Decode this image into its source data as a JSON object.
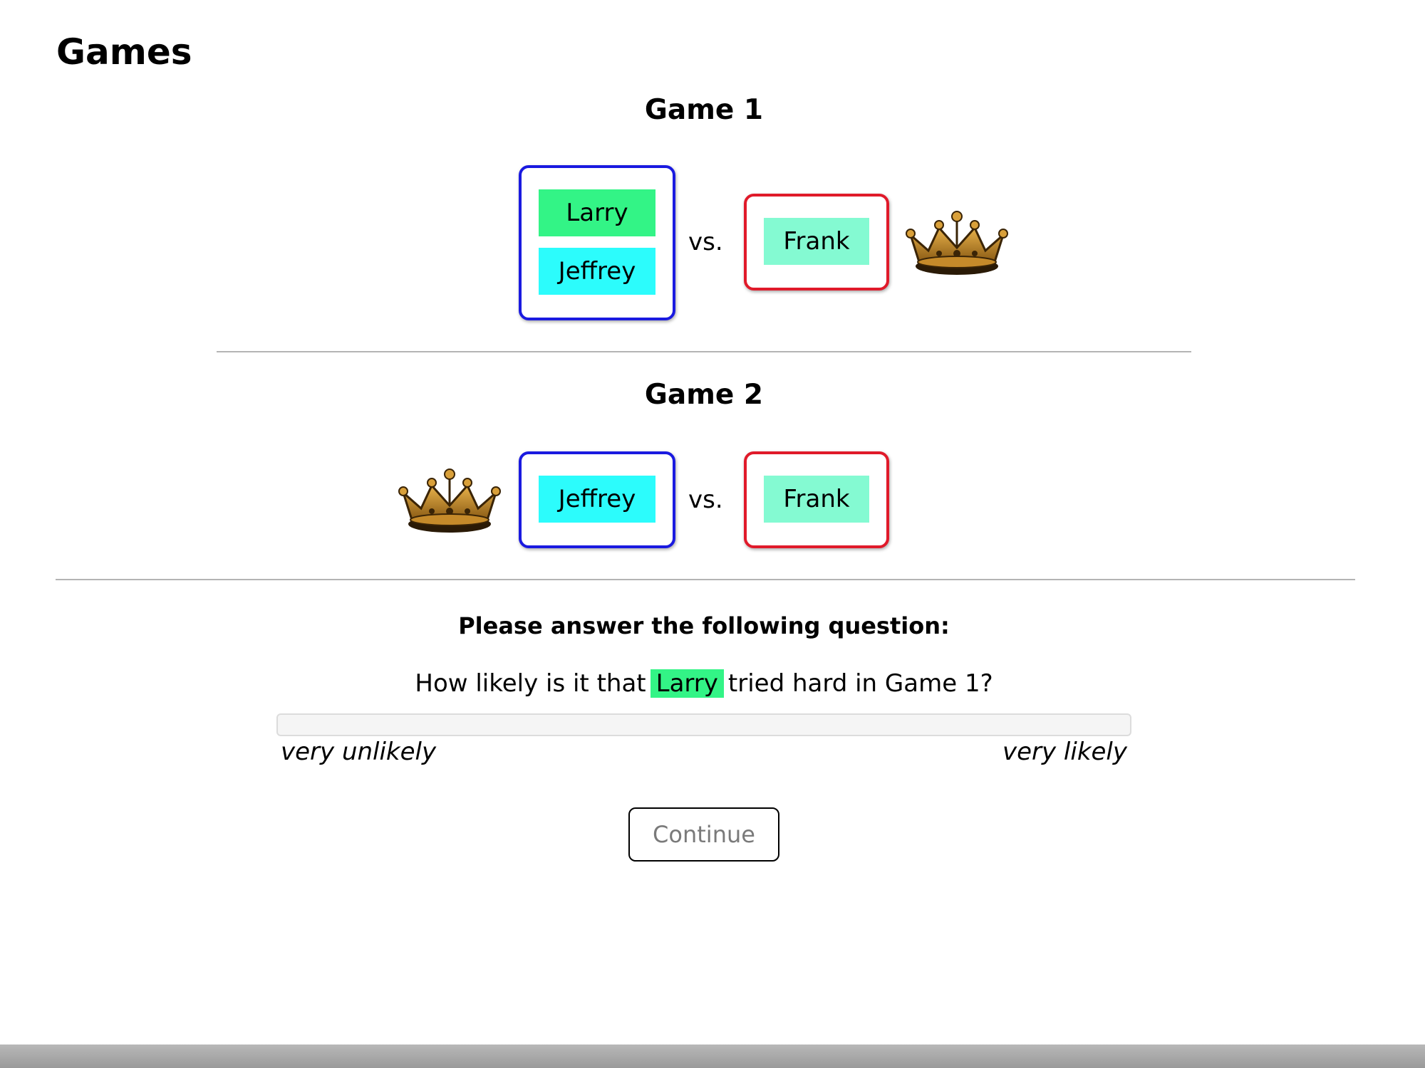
{
  "page": {
    "title": "Games"
  },
  "colors": {
    "team_left_border": "#1a1ae0",
    "team_right_border": "#e01a2a",
    "larry": "#33f486",
    "jeffrey": "#2cfcfc",
    "frank": "#84fad2",
    "crown": "crown-icon"
  },
  "games": [
    {
      "heading": "Game 1",
      "left_team": [
        "Larry",
        "Jeffrey"
      ],
      "vs": "vs.",
      "right_team": [
        "Frank"
      ],
      "winner": "right"
    },
    {
      "heading": "Game 2",
      "left_team": [
        "Jeffrey"
      ],
      "vs": "vs.",
      "right_team": [
        "Frank"
      ],
      "winner": "left"
    }
  ],
  "question": {
    "heading": "Please answer the following question:",
    "prefix": "How likely is it that",
    "subject": "Larry",
    "suffix": "tried hard in Game 1?",
    "slider": {
      "min_label": "very unlikely",
      "max_label": "very likely",
      "value": null
    }
  },
  "continue_button": {
    "label": "Continue",
    "enabled": false
  }
}
